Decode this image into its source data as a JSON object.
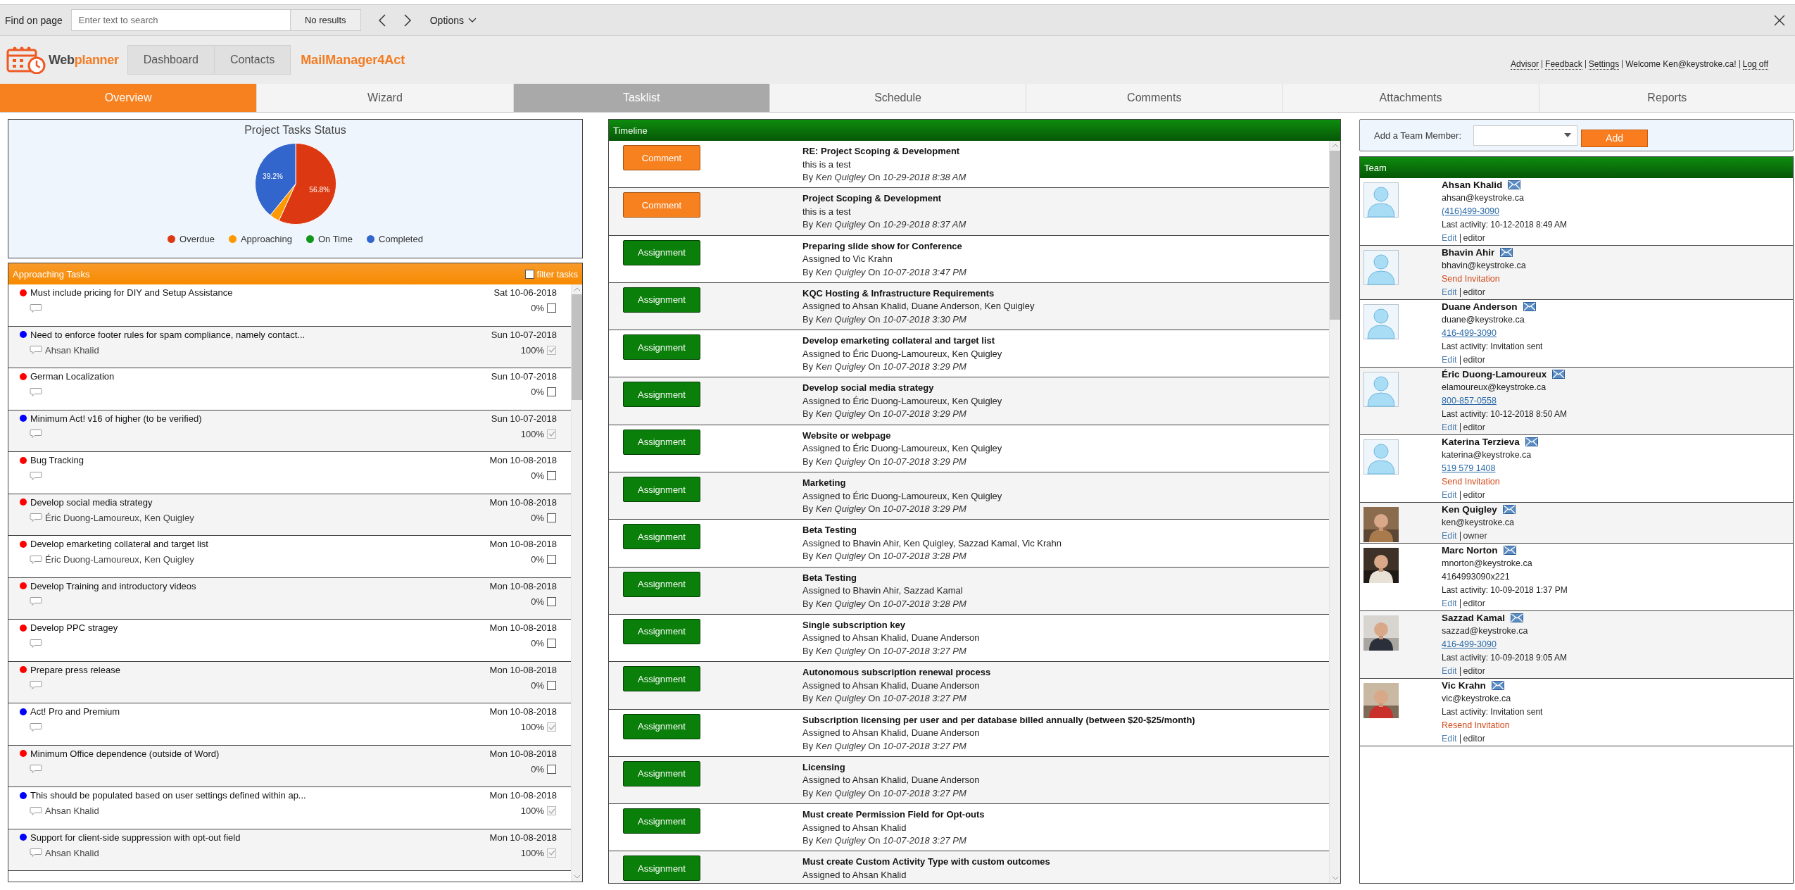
{
  "find_bar": {
    "label": "Find on page",
    "placeholder": "Enter text to search",
    "result": "No results",
    "options": "Options"
  },
  "header": {
    "logo": {
      "part1": "Web",
      "part2": "planner"
    },
    "nav": [
      "Dashboard",
      "Contacts"
    ],
    "app_name": "MailManager4Act",
    "links": [
      {
        "kind": "link",
        "text": "Advisor"
      },
      {
        "kind": "link",
        "text": "Feedback"
      },
      {
        "kind": "link",
        "text": "Settings"
      },
      {
        "kind": "text",
        "text": "Welcome Ken@keystroke.ca!"
      },
      {
        "kind": "link",
        "text": "Log off"
      }
    ]
  },
  "tabs": [
    {
      "label": "Overview",
      "selected": true,
      "disabled": false
    },
    {
      "label": "Wizard",
      "selected": false,
      "disabled": false
    },
    {
      "label": "Tasklist",
      "selected": false,
      "disabled": true
    },
    {
      "label": "Schedule",
      "selected": false,
      "disabled": false
    },
    {
      "label": "Comments",
      "selected": false,
      "disabled": false
    },
    {
      "label": "Attachments",
      "selected": false,
      "disabled": false
    },
    {
      "label": "Reports",
      "selected": false,
      "disabled": false
    }
  ],
  "status_chart": {
    "chart_data": {
      "type": "pie",
      "title": "Project Tasks Status",
      "categories": [
        "Overdue",
        "Approaching",
        "On Time",
        "Completed"
      ],
      "values": [
        56.8,
        4.0,
        0,
        39.2
      ],
      "colors": [
        "#dc3912",
        "#ff9900",
        "#109618",
        "#3366cc"
      ],
      "value_labels": [
        "56.8%",
        null,
        null,
        "39.2%"
      ]
    }
  },
  "approaching_tasks": {
    "title": "Approaching Tasks",
    "filter": {
      "label": "filter tasks",
      "checked": false
    },
    "rows": [
      {
        "color": "#ff0000",
        "title": "Must include pricing for DIY and Setup Assistance",
        "date": "Sat 10-06-2018",
        "percent": "0%",
        "checked": false
      },
      {
        "color": "#0000ff",
        "title": "Need to enforce footer rules for spam compliance, namely contact...",
        "date": "Sun 10-07-2018",
        "assignees": "Ahsan Khalid",
        "percent": "100%",
        "checked": true
      },
      {
        "color": "#ff0000",
        "title": "German Localization",
        "date": "Sun 10-07-2018",
        "percent": "0%",
        "checked": false
      },
      {
        "color": "#0000ff",
        "title": "Minimum Act! v16 of higher (to be verified)",
        "date": "Sun 10-07-2018",
        "percent": "100%",
        "checked": true
      },
      {
        "color": "#ff0000",
        "title": "Bug Tracking",
        "date": "Mon 10-08-2018",
        "percent": "0%",
        "checked": false
      },
      {
        "color": "#ff0000",
        "title": "Develop social media strategy",
        "date": "Mon 10-08-2018",
        "assignees": "Éric Duong-Lamoureux, Ken Quigley",
        "percent": "0%",
        "checked": false
      },
      {
        "color": "#ff0000",
        "title": "Develop emarketing collateral and target list",
        "date": "Mon 10-08-2018",
        "assignees": "Éric Duong-Lamoureux, Ken Quigley",
        "percent": "0%",
        "checked": false
      },
      {
        "color": "#ff0000",
        "title": "Develop Training and introductory videos",
        "date": "Mon 10-08-2018",
        "percent": "0%",
        "checked": false
      },
      {
        "color": "#ff0000",
        "title": "Develop PPC stragey",
        "date": "Mon 10-08-2018",
        "percent": "0%",
        "checked": false
      },
      {
        "color": "#ff0000",
        "title": "Prepare press release",
        "date": "Mon 10-08-2018",
        "percent": "0%",
        "checked": false
      },
      {
        "color": "#0000ff",
        "title": "Act! Pro and Premium",
        "date": "Mon 10-08-2018",
        "percent": "100%",
        "checked": true
      },
      {
        "color": "#ff0000",
        "title": "Minimum Office dependence (outside of Word)",
        "date": "Mon 10-08-2018",
        "percent": "0%",
        "checked": false
      },
      {
        "color": "#0000ff",
        "title": "This should be populated based on user settings defined within ap...",
        "date": "Mon 10-08-2018",
        "assignees": "Ahsan Khalid",
        "percent": "100%",
        "checked": true
      },
      {
        "color": "#0000ff",
        "title": "Support for client-side suppression with opt-out field",
        "date": "Mon 10-08-2018",
        "assignees": "Ahsan Khalid",
        "percent": "100%",
        "checked": true
      }
    ]
  },
  "timeline": {
    "title": "Timeline",
    "items": [
      {
        "kind": "comment",
        "button": "Comment",
        "title": "RE: Project Scoping & Development",
        "detail": "this is a test",
        "by": "By *Ken Quigley* On *10-29-2018 8:38 AM*"
      },
      {
        "kind": "comment",
        "button": "Comment",
        "title": "Project Scoping & Development",
        "detail": "this is a test",
        "by": "By *Ken Quigley* On *10-29-2018 8:37 AM*"
      },
      {
        "kind": "assignment",
        "button": "Assignment",
        "title": "Preparing slide show for Conference",
        "detail": "Assigned to Vic Krahn",
        "by": "By *Ken Quigley* On *10-07-2018 3:47 PM*"
      },
      {
        "kind": "assignment",
        "button": "Assignment",
        "title": "KQC Hosting & Infrastructure Requirements",
        "detail": "Assigned to Ahsan Khalid, Duane Anderson, Ken Quigley",
        "by": "By *Ken Quigley* On *10-07-2018 3:30 PM*"
      },
      {
        "kind": "assignment",
        "button": "Assignment",
        "title": "Develop emarketing collateral and target list",
        "detail": "Assigned to Éric Duong-Lamoureux, Ken Quigley",
        "by": "By *Ken Quigley* On *10-07-2018 3:29 PM*"
      },
      {
        "kind": "assignment",
        "button": "Assignment",
        "title": "Develop social media strategy",
        "detail": "Assigned to Éric Duong-Lamoureux, Ken Quigley",
        "by": "By *Ken Quigley* On *10-07-2018 3:29 PM*"
      },
      {
        "kind": "assignment",
        "button": "Assignment",
        "title": "Website or webpage",
        "detail": "Assigned to Éric Duong-Lamoureux, Ken Quigley",
        "by": "By *Ken Quigley* On *10-07-2018 3:29 PM*"
      },
      {
        "kind": "assignment",
        "button": "Assignment",
        "title": "Marketing",
        "detail": "Assigned to Éric Duong-Lamoureux, Ken Quigley",
        "by": "By *Ken Quigley* On *10-07-2018 3:29 PM*"
      },
      {
        "kind": "assignment",
        "button": "Assignment",
        "title": "Beta Testing",
        "detail": "Assigned to Bhavin Ahir, Ken Quigley, Sazzad Kamal, Vic Krahn",
        "by": "By *Ken Quigley* On *10-07-2018 3:28 PM*"
      },
      {
        "kind": "assignment",
        "button": "Assignment",
        "title": "Beta Testing",
        "detail": "Assigned to Bhavin Ahir, Sazzad Kamal",
        "by": "By *Ken Quigley* On *10-07-2018 3:28 PM*"
      },
      {
        "kind": "assignment",
        "button": "Assignment",
        "title": "Single subscription key",
        "detail": "Assigned to Ahsan Khalid, Duane Anderson",
        "by": "By *Ken Quigley* On *10-07-2018 3:27 PM*"
      },
      {
        "kind": "assignment",
        "button": "Assignment",
        "title": "Autonomous subscription renewal process",
        "detail": "Assigned to Ahsan Khalid, Duane Anderson",
        "by": "By *Ken Quigley* On *10-07-2018 3:27 PM*"
      },
      {
        "kind": "assignment",
        "button": "Assignment",
        "title": "Subscription licensing per user and per database billed annually (between $20-$25/month)",
        "detail": "Assigned to Ahsan Khalid, Duane Anderson",
        "by": "By *Ken Quigley* On *10-07-2018 3:27 PM*"
      },
      {
        "kind": "assignment",
        "button": "Assignment",
        "title": "Licensing",
        "detail": "Assigned to Ahsan Khalid, Duane Anderson",
        "by": "By *Ken Quigley* On *10-07-2018 3:27 PM*"
      },
      {
        "kind": "assignment",
        "button": "Assignment",
        "title": "Must create Permission Field for Opt-outs",
        "detail": "Assigned to Ahsan Khalid",
        "by": "By *Ken Quigley* On *10-07-2018 3:27 PM*"
      },
      {
        "kind": "assignment",
        "button": "Assignment",
        "title": "Must create Custom Activity Type with custom outcomes",
        "detail": "Assigned to Ahsan Khalid"
      }
    ]
  },
  "add_member": {
    "label": "Add a Team Member:",
    "button": "Add"
  },
  "team": {
    "title": "Team",
    "members": [
      {
        "avatar": {
          "kind": "placeholder"
        },
        "name": "Ahsan Khalid",
        "lines": [
          {
            "kind": "email",
            "text": "ahsan@keystroke.ca"
          },
          {
            "kind": "phone_link",
            "text": "(416)499-3090"
          },
          {
            "kind": "activity",
            "text": "Last activity: 10-12-2018 8:49 AM"
          }
        ],
        "edit": "Edit",
        "role": "editor"
      },
      {
        "avatar": {
          "kind": "placeholder"
        },
        "name": "Bhavin Ahir",
        "lines": [
          {
            "kind": "email",
            "text": "bhavin@keystroke.ca"
          },
          {
            "kind": "invite",
            "text": "Send Invitation"
          }
        ],
        "edit": "Edit",
        "role": "editor"
      },
      {
        "avatar": {
          "kind": "placeholder"
        },
        "name": "Duane Anderson",
        "lines": [
          {
            "kind": "email",
            "text": "duane@keystroke.ca"
          },
          {
            "kind": "phone_link",
            "text": "416-499-3090"
          },
          {
            "kind": "activity",
            "text": "Last activity: Invitation sent"
          }
        ],
        "edit": "Edit",
        "role": "editor"
      },
      {
        "avatar": {
          "kind": "placeholder"
        },
        "name": "Éric Duong-Lamoureux",
        "lines": [
          {
            "kind": "email",
            "text": "elamoureux@keystroke.ca"
          },
          {
            "kind": "phone_link",
            "text": "800-857-0558"
          },
          {
            "kind": "activity",
            "text": "Last activity: 10-12-2018 8:50 AM"
          }
        ],
        "edit": "Edit",
        "role": "editor"
      },
      {
        "avatar": {
          "kind": "placeholder"
        },
        "name": "Katerina Terzieva",
        "lines": [
          {
            "kind": "email",
            "text": "katerina@keystroke.ca"
          },
          {
            "kind": "phone_link",
            "text": "519 579 1408"
          },
          {
            "kind": "invite",
            "text": "Send Invitation"
          }
        ],
        "edit": "Edit",
        "role": "editor"
      },
      {
        "avatar": {
          "kind": "picture"
        },
        "name": "Ken Quigley",
        "lines": [
          {
            "kind": "email",
            "text": "ken@keystroke.ca"
          }
        ],
        "edit": "Edit",
        "role": "owner"
      },
      {
        "avatar": {
          "kind": "picture"
        },
        "name": "Marc Norton",
        "lines": [
          {
            "kind": "email",
            "text": "mnorton@keystroke.ca"
          },
          {
            "kind": "phone",
            "text": "4164993090x221"
          },
          {
            "kind": "activity",
            "text": "Last activity: 10-09-2018 1:37 PM"
          }
        ],
        "edit": "Edit",
        "role": "editor"
      },
      {
        "avatar": {
          "kind": "picture"
        },
        "name": "Sazzad Kamal",
        "lines": [
          {
            "kind": "email",
            "text": "sazzad@keystroke.ca"
          },
          {
            "kind": "phone_link",
            "text": "416-499-3090"
          },
          {
            "kind": "activity",
            "text": "Last activity: 10-09-2018 9:05 AM"
          }
        ],
        "edit": "Edit",
        "role": "editor"
      },
      {
        "avatar": {
          "kind": "picture"
        },
        "name": "Vic Krahn",
        "lines": [
          {
            "kind": "email",
            "text": "vic@keystroke.ca"
          },
          {
            "kind": "activity",
            "text": "Last activity: Invitation sent"
          },
          {
            "kind": "invite",
            "text": "Resend Invitation"
          }
        ],
        "edit": "Edit",
        "role": "editor"
      }
    ]
  }
}
